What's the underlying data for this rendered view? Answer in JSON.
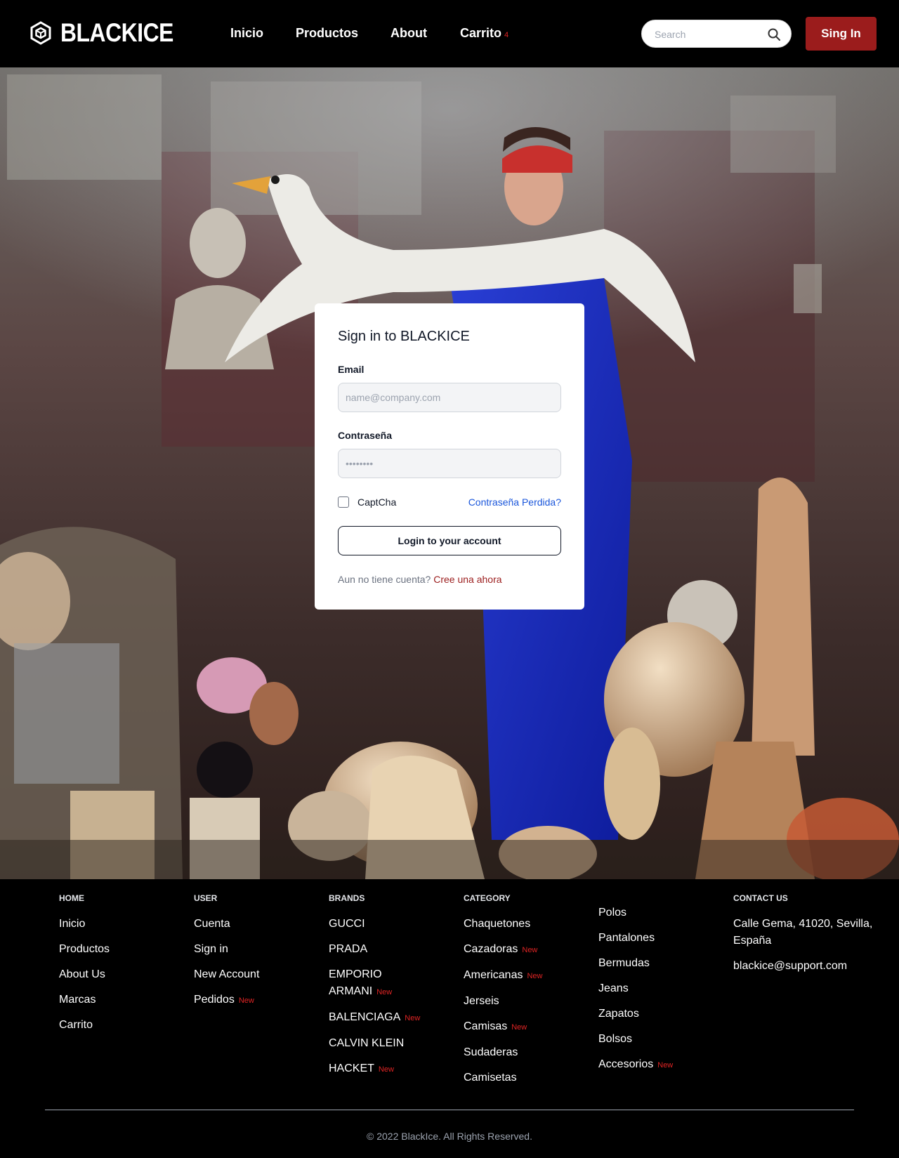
{
  "header": {
    "brand": "BLACKICE",
    "nav": [
      {
        "label": "Inicio"
      },
      {
        "label": "Productos"
      },
      {
        "label": "About"
      },
      {
        "label": "Carrito",
        "count": "4"
      }
    ],
    "search_placeholder": "Search",
    "signin_label": "Sing In",
    "icons": {
      "logo": "hexagon-cube-logo",
      "search": "magnifier-icon"
    },
    "colors": {
      "accent": "#9b1c1c",
      "badge": "#e02424"
    }
  },
  "hero": {
    "image_description_icon": "hero-photo"
  },
  "login": {
    "title": "Sign in to BLACKICE",
    "email_label": "Email",
    "email_placeholder": "name@company.com",
    "password_label": "Contraseña",
    "password_placeholder": "••••••••",
    "captcha_label": "CaptCha",
    "lost_password": "Contraseña Perdida?",
    "submit_label": "Login to your account",
    "register_text": "Aun no tiene cuenta?",
    "register_link": "Cree una ahora"
  },
  "footer": {
    "home": {
      "heading": "HOME",
      "items": [
        "Inicio",
        "Productos",
        "About Us",
        "Marcas",
        "Carrito"
      ]
    },
    "user": {
      "heading": "USER",
      "items": [
        "Cuenta",
        "Sign in",
        "New Account",
        "Pedidos"
      ],
      "new_badge": "New"
    },
    "brands": {
      "heading": "BRANDS",
      "items": [
        "GUCCI",
        "PRADA",
        "EMPORIO ARMANI",
        "BALENCIAGA",
        "CALVIN KLEIN",
        "HACKET"
      ]
    },
    "category": {
      "heading": "CATEGORY",
      "items": [
        "Chaquetones",
        "Cazadoras",
        "Americanas",
        "Jerseis",
        "Camisas",
        "Sudaderas",
        "Camisetas"
      ]
    },
    "category2": {
      "items": [
        "Polos",
        "Pantalones",
        "Bermudas",
        "Jeans",
        "Zapatos",
        "Bolsos",
        "Accesorios"
      ]
    },
    "contact": {
      "heading": "CONTACT US",
      "address": "Calle Gema, 41020, Sevilla, España",
      "email": "blackice@support.com"
    },
    "badge_label": "New",
    "copyright": "© 2022 BlackIce. All Rights Reserved."
  }
}
